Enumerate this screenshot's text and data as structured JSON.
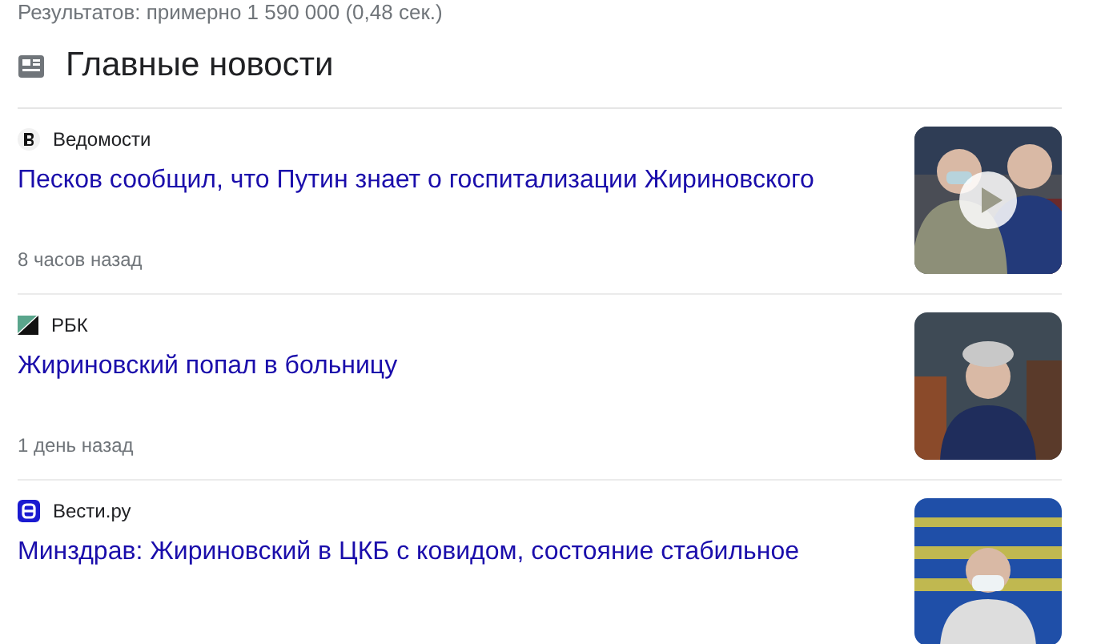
{
  "result_stats": "Результатов: примерно 1 590 000 (0,48 сек.)",
  "section": {
    "title": "Главные новости"
  },
  "articles": [
    {
      "source": "Ведомости",
      "title": "Песков сообщил, что Путин знает о госпитализации Жириновского",
      "time": "8 часов назад",
      "video": true
    },
    {
      "source": "РБК",
      "title": "Жириновский попал в больницу",
      "time": "1 день назад",
      "video": false
    },
    {
      "source": "Вести.ру",
      "title": "Минздрав: Жириновский в ЦКБ с ковидом, состояние стабильное",
      "video": false
    }
  ]
}
